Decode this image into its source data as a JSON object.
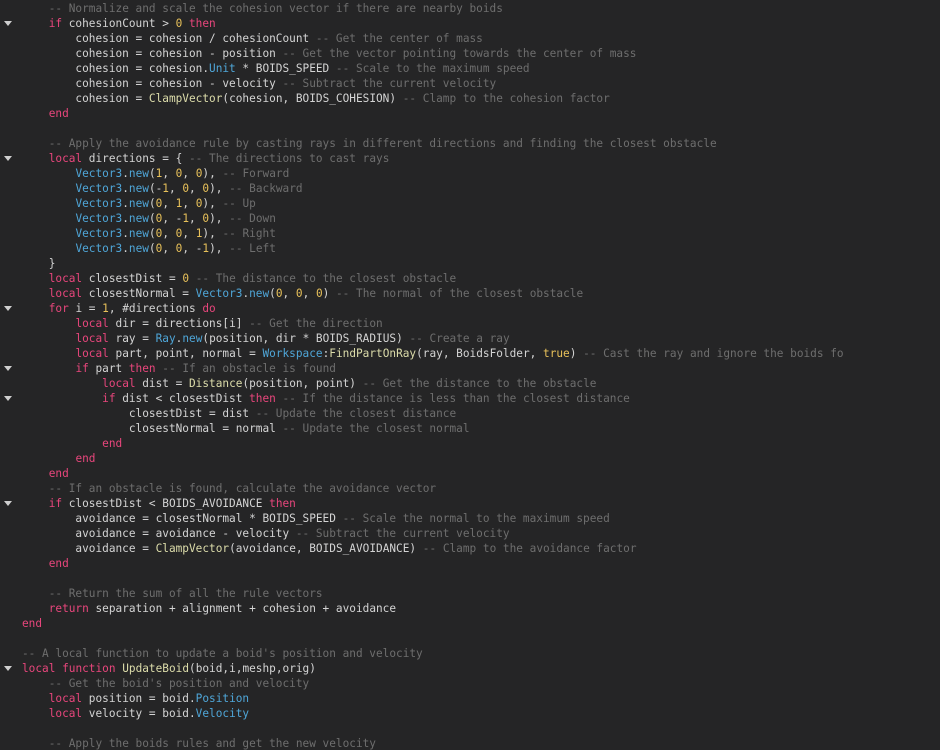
{
  "theme": {
    "background": "#252526",
    "default_text": "#d4d4d4",
    "keyword": "#e8467c",
    "comment": "#6e6e6e",
    "function": "#dcdcaa",
    "number": "#e8c15a",
    "builtin": "#4fa6d8"
  },
  "lines": [
    {
      "fold": false,
      "tokens": [
        {
          "t": "    ",
          "c": "tx"
        },
        {
          "t": "-- Normalize and scale the cohesion vector if there are nearby boids",
          "c": "cm"
        }
      ]
    },
    {
      "fold": true,
      "tokens": [
        {
          "t": "    ",
          "c": "tx"
        },
        {
          "t": "if",
          "c": "kw"
        },
        {
          "t": " cohesionCount > ",
          "c": "tx"
        },
        {
          "t": "0",
          "c": "num"
        },
        {
          "t": " ",
          "c": "tx"
        },
        {
          "t": "then",
          "c": "kw"
        }
      ]
    },
    {
      "fold": false,
      "tokens": [
        {
          "t": "        cohesion = cohesion / cohesionCount ",
          "c": "tx"
        },
        {
          "t": "-- Get the center of mass",
          "c": "cm"
        }
      ]
    },
    {
      "fold": false,
      "tokens": [
        {
          "t": "        cohesion = cohesion - position ",
          "c": "tx"
        },
        {
          "t": "-- Get the vector pointing towards the center of mass",
          "c": "cm"
        }
      ]
    },
    {
      "fold": false,
      "tokens": [
        {
          "t": "        cohesion = cohesion.",
          "c": "tx"
        },
        {
          "t": "Unit",
          "c": "bi"
        },
        {
          "t": " * BOIDS_SPEED ",
          "c": "tx"
        },
        {
          "t": "-- Scale to the maximum speed",
          "c": "cm"
        }
      ]
    },
    {
      "fold": false,
      "tokens": [
        {
          "t": "        cohesion = cohesion - velocity ",
          "c": "tx"
        },
        {
          "t": "-- Subtract the current velocity",
          "c": "cm"
        }
      ]
    },
    {
      "fold": false,
      "tokens": [
        {
          "t": "        cohesion = ",
          "c": "tx"
        },
        {
          "t": "ClampVector",
          "c": "fn"
        },
        {
          "t": "(cohesion, BOIDS_COHESION) ",
          "c": "tx"
        },
        {
          "t": "-- Clamp to the cohesion factor",
          "c": "cm"
        }
      ]
    },
    {
      "fold": false,
      "tokens": [
        {
          "t": "    ",
          "c": "tx"
        },
        {
          "t": "end",
          "c": "kw"
        }
      ]
    },
    {
      "fold": false,
      "tokens": [
        {
          "t": "",
          "c": "tx"
        }
      ]
    },
    {
      "fold": false,
      "tokens": [
        {
          "t": "    ",
          "c": "tx"
        },
        {
          "t": "-- Apply the avoidance rule by casting rays in different directions and finding the closest obstacle",
          "c": "cm"
        }
      ]
    },
    {
      "fold": true,
      "tokens": [
        {
          "t": "    ",
          "c": "tx"
        },
        {
          "t": "local",
          "c": "kw"
        },
        {
          "t": " directions = { ",
          "c": "tx"
        },
        {
          "t": "-- The directions to cast rays",
          "c": "cm"
        }
      ]
    },
    {
      "fold": false,
      "tokens": [
        {
          "t": "        ",
          "c": "tx"
        },
        {
          "t": "Vector3",
          "c": "bi"
        },
        {
          "t": ".",
          "c": "tx"
        },
        {
          "t": "new",
          "c": "bi"
        },
        {
          "t": "(",
          "c": "tx"
        },
        {
          "t": "1",
          "c": "num"
        },
        {
          "t": ", ",
          "c": "tx"
        },
        {
          "t": "0",
          "c": "num"
        },
        {
          "t": ", ",
          "c": "tx"
        },
        {
          "t": "0",
          "c": "num"
        },
        {
          "t": "), ",
          "c": "tx"
        },
        {
          "t": "-- Forward",
          "c": "cm"
        }
      ]
    },
    {
      "fold": false,
      "tokens": [
        {
          "t": "        ",
          "c": "tx"
        },
        {
          "t": "Vector3",
          "c": "bi"
        },
        {
          "t": ".",
          "c": "tx"
        },
        {
          "t": "new",
          "c": "bi"
        },
        {
          "t": "(-",
          "c": "tx"
        },
        {
          "t": "1",
          "c": "num"
        },
        {
          "t": ", ",
          "c": "tx"
        },
        {
          "t": "0",
          "c": "num"
        },
        {
          "t": ", ",
          "c": "tx"
        },
        {
          "t": "0",
          "c": "num"
        },
        {
          "t": "), ",
          "c": "tx"
        },
        {
          "t": "-- Backward",
          "c": "cm"
        }
      ]
    },
    {
      "fold": false,
      "tokens": [
        {
          "t": "        ",
          "c": "tx"
        },
        {
          "t": "Vector3",
          "c": "bi"
        },
        {
          "t": ".",
          "c": "tx"
        },
        {
          "t": "new",
          "c": "bi"
        },
        {
          "t": "(",
          "c": "tx"
        },
        {
          "t": "0",
          "c": "num"
        },
        {
          "t": ", ",
          "c": "tx"
        },
        {
          "t": "1",
          "c": "num"
        },
        {
          "t": ", ",
          "c": "tx"
        },
        {
          "t": "0",
          "c": "num"
        },
        {
          "t": "), ",
          "c": "tx"
        },
        {
          "t": "-- Up",
          "c": "cm"
        }
      ]
    },
    {
      "fold": false,
      "tokens": [
        {
          "t": "        ",
          "c": "tx"
        },
        {
          "t": "Vector3",
          "c": "bi"
        },
        {
          "t": ".",
          "c": "tx"
        },
        {
          "t": "new",
          "c": "bi"
        },
        {
          "t": "(",
          "c": "tx"
        },
        {
          "t": "0",
          "c": "num"
        },
        {
          "t": ", -",
          "c": "tx"
        },
        {
          "t": "1",
          "c": "num"
        },
        {
          "t": ", ",
          "c": "tx"
        },
        {
          "t": "0",
          "c": "num"
        },
        {
          "t": "), ",
          "c": "tx"
        },
        {
          "t": "-- Down",
          "c": "cm"
        }
      ]
    },
    {
      "fold": false,
      "tokens": [
        {
          "t": "        ",
          "c": "tx"
        },
        {
          "t": "Vector3",
          "c": "bi"
        },
        {
          "t": ".",
          "c": "tx"
        },
        {
          "t": "new",
          "c": "bi"
        },
        {
          "t": "(",
          "c": "tx"
        },
        {
          "t": "0",
          "c": "num"
        },
        {
          "t": ", ",
          "c": "tx"
        },
        {
          "t": "0",
          "c": "num"
        },
        {
          "t": ", ",
          "c": "tx"
        },
        {
          "t": "1",
          "c": "num"
        },
        {
          "t": "), ",
          "c": "tx"
        },
        {
          "t": "-- Right",
          "c": "cm"
        }
      ]
    },
    {
      "fold": false,
      "tokens": [
        {
          "t": "        ",
          "c": "tx"
        },
        {
          "t": "Vector3",
          "c": "bi"
        },
        {
          "t": ".",
          "c": "tx"
        },
        {
          "t": "new",
          "c": "bi"
        },
        {
          "t": "(",
          "c": "tx"
        },
        {
          "t": "0",
          "c": "num"
        },
        {
          "t": ", ",
          "c": "tx"
        },
        {
          "t": "0",
          "c": "num"
        },
        {
          "t": ", -",
          "c": "tx"
        },
        {
          "t": "1",
          "c": "num"
        },
        {
          "t": "), ",
          "c": "tx"
        },
        {
          "t": "-- Left",
          "c": "cm"
        }
      ]
    },
    {
      "fold": false,
      "tokens": [
        {
          "t": "    }",
          "c": "tx"
        }
      ]
    },
    {
      "fold": false,
      "tokens": [
        {
          "t": "    ",
          "c": "tx"
        },
        {
          "t": "local",
          "c": "kw"
        },
        {
          "t": " closestDist = ",
          "c": "tx"
        },
        {
          "t": "0",
          "c": "num"
        },
        {
          "t": " ",
          "c": "tx"
        },
        {
          "t": "-- The distance to the closest obstacle",
          "c": "cm"
        }
      ]
    },
    {
      "fold": false,
      "tokens": [
        {
          "t": "    ",
          "c": "tx"
        },
        {
          "t": "local",
          "c": "kw"
        },
        {
          "t": " closestNormal = ",
          "c": "tx"
        },
        {
          "t": "Vector3",
          "c": "bi"
        },
        {
          "t": ".",
          "c": "tx"
        },
        {
          "t": "new",
          "c": "bi"
        },
        {
          "t": "(",
          "c": "tx"
        },
        {
          "t": "0",
          "c": "num"
        },
        {
          "t": ", ",
          "c": "tx"
        },
        {
          "t": "0",
          "c": "num"
        },
        {
          "t": ", ",
          "c": "tx"
        },
        {
          "t": "0",
          "c": "num"
        },
        {
          "t": ") ",
          "c": "tx"
        },
        {
          "t": "-- The normal of the closest obstacle",
          "c": "cm"
        }
      ]
    },
    {
      "fold": true,
      "tokens": [
        {
          "t": "    ",
          "c": "tx"
        },
        {
          "t": "for",
          "c": "kw"
        },
        {
          "t": " i = ",
          "c": "tx"
        },
        {
          "t": "1",
          "c": "num"
        },
        {
          "t": ", #directions ",
          "c": "tx"
        },
        {
          "t": "do",
          "c": "kw"
        }
      ]
    },
    {
      "fold": false,
      "tokens": [
        {
          "t": "        ",
          "c": "tx"
        },
        {
          "t": "local",
          "c": "kw"
        },
        {
          "t": " dir = directions[i] ",
          "c": "tx"
        },
        {
          "t": "-- Get the direction",
          "c": "cm"
        }
      ]
    },
    {
      "fold": false,
      "tokens": [
        {
          "t": "        ",
          "c": "tx"
        },
        {
          "t": "local",
          "c": "kw"
        },
        {
          "t": " ray = ",
          "c": "tx"
        },
        {
          "t": "Ray",
          "c": "bi"
        },
        {
          "t": ".",
          "c": "tx"
        },
        {
          "t": "new",
          "c": "bi"
        },
        {
          "t": "(position, dir * BOIDS_RADIUS) ",
          "c": "tx"
        },
        {
          "t": "-- Create a ray",
          "c": "cm"
        }
      ]
    },
    {
      "fold": false,
      "tokens": [
        {
          "t": "        ",
          "c": "tx"
        },
        {
          "t": "local",
          "c": "kw"
        },
        {
          "t": " part, point, normal = ",
          "c": "tx"
        },
        {
          "t": "Workspace",
          "c": "bi"
        },
        {
          "t": ":",
          "c": "tx"
        },
        {
          "t": "FindPartOnRay",
          "c": "fn"
        },
        {
          "t": "(ray, BoidsFolder, ",
          "c": "tx"
        },
        {
          "t": "true",
          "c": "num"
        },
        {
          "t": ") ",
          "c": "tx"
        },
        {
          "t": "-- Cast the ray and ignore the boids fo",
          "c": "cm"
        }
      ]
    },
    {
      "fold": true,
      "tokens": [
        {
          "t": "        ",
          "c": "tx"
        },
        {
          "t": "if",
          "c": "kw"
        },
        {
          "t": " part ",
          "c": "tx"
        },
        {
          "t": "then",
          "c": "kw"
        },
        {
          "t": " ",
          "c": "tx"
        },
        {
          "t": "-- If an obstacle is found",
          "c": "cm"
        }
      ]
    },
    {
      "fold": false,
      "tokens": [
        {
          "t": "            ",
          "c": "tx"
        },
        {
          "t": "local",
          "c": "kw"
        },
        {
          "t": " dist = ",
          "c": "tx"
        },
        {
          "t": "Distance",
          "c": "fn"
        },
        {
          "t": "(position, point) ",
          "c": "tx"
        },
        {
          "t": "-- Get the distance to the obstacle",
          "c": "cm"
        }
      ]
    },
    {
      "fold": true,
      "tokens": [
        {
          "t": "            ",
          "c": "tx"
        },
        {
          "t": "if",
          "c": "kw"
        },
        {
          "t": " dist < closestDist ",
          "c": "tx"
        },
        {
          "t": "then",
          "c": "kw"
        },
        {
          "t": " ",
          "c": "tx"
        },
        {
          "t": "-- If the distance is less than the closest distance",
          "c": "cm"
        }
      ]
    },
    {
      "fold": false,
      "tokens": [
        {
          "t": "                closestDist = dist ",
          "c": "tx"
        },
        {
          "t": "-- Update the closest distance",
          "c": "cm"
        }
      ]
    },
    {
      "fold": false,
      "tokens": [
        {
          "t": "                closestNormal = normal ",
          "c": "tx"
        },
        {
          "t": "-- Update the closest normal",
          "c": "cm"
        }
      ]
    },
    {
      "fold": false,
      "tokens": [
        {
          "t": "            ",
          "c": "tx"
        },
        {
          "t": "end",
          "c": "kw"
        }
      ]
    },
    {
      "fold": false,
      "tokens": [
        {
          "t": "        ",
          "c": "tx"
        },
        {
          "t": "end",
          "c": "kw"
        }
      ]
    },
    {
      "fold": false,
      "tokens": [
        {
          "t": "    ",
          "c": "tx"
        },
        {
          "t": "end",
          "c": "kw"
        }
      ]
    },
    {
      "fold": false,
      "tokens": [
        {
          "t": "    ",
          "c": "tx"
        },
        {
          "t": "-- If an obstacle is found, calculate the avoidance vector",
          "c": "cm"
        }
      ]
    },
    {
      "fold": true,
      "tokens": [
        {
          "t": "    ",
          "c": "tx"
        },
        {
          "t": "if",
          "c": "kw"
        },
        {
          "t": " closestDist < BOIDS_AVOIDANCE ",
          "c": "tx"
        },
        {
          "t": "then",
          "c": "kw"
        }
      ]
    },
    {
      "fold": false,
      "tokens": [
        {
          "t": "        avoidance = closestNormal * BOIDS_SPEED ",
          "c": "tx"
        },
        {
          "t": "-- Scale the normal to the maximum speed",
          "c": "cm"
        }
      ]
    },
    {
      "fold": false,
      "tokens": [
        {
          "t": "        avoidance = avoidance - velocity ",
          "c": "tx"
        },
        {
          "t": "-- Subtract the current velocity",
          "c": "cm"
        }
      ]
    },
    {
      "fold": false,
      "tokens": [
        {
          "t": "        avoidance = ",
          "c": "tx"
        },
        {
          "t": "ClampVector",
          "c": "fn"
        },
        {
          "t": "(avoidance, BOIDS_AVOIDANCE) ",
          "c": "tx"
        },
        {
          "t": "-- Clamp to the avoidance factor",
          "c": "cm"
        }
      ]
    },
    {
      "fold": false,
      "tokens": [
        {
          "t": "    ",
          "c": "tx"
        },
        {
          "t": "end",
          "c": "kw"
        }
      ]
    },
    {
      "fold": false,
      "tokens": [
        {
          "t": "",
          "c": "tx"
        }
      ]
    },
    {
      "fold": false,
      "tokens": [
        {
          "t": "    ",
          "c": "tx"
        },
        {
          "t": "-- Return the sum of all the rule vectors",
          "c": "cm"
        }
      ]
    },
    {
      "fold": false,
      "tokens": [
        {
          "t": "    ",
          "c": "tx"
        },
        {
          "t": "return",
          "c": "kw"
        },
        {
          "t": " separation + alignment + cohesion + avoidance",
          "c": "tx"
        }
      ]
    },
    {
      "fold": false,
      "tokens": [
        {
          "t": "end",
          "c": "kw"
        }
      ]
    },
    {
      "fold": false,
      "tokens": [
        {
          "t": "",
          "c": "tx"
        }
      ]
    },
    {
      "fold": false,
      "tokens": [
        {
          "t": "-- A local function to update a boid's position and velocity",
          "c": "cm"
        }
      ]
    },
    {
      "fold": true,
      "tokens": [
        {
          "t": "local",
          "c": "kw"
        },
        {
          "t": " ",
          "c": "tx"
        },
        {
          "t": "function",
          "c": "kw"
        },
        {
          "t": " ",
          "c": "tx"
        },
        {
          "t": "UpdateBoid",
          "c": "fn"
        },
        {
          "t": "(boid,i,meshp,orig)",
          "c": "tx"
        }
      ]
    },
    {
      "fold": false,
      "tokens": [
        {
          "t": "    ",
          "c": "tx"
        },
        {
          "t": "-- Get the boid's position and velocity",
          "c": "cm"
        }
      ]
    },
    {
      "fold": false,
      "tokens": [
        {
          "t": "    ",
          "c": "tx"
        },
        {
          "t": "local",
          "c": "kw"
        },
        {
          "t": " position = boid.",
          "c": "tx"
        },
        {
          "t": "Position",
          "c": "bi"
        }
      ]
    },
    {
      "fold": false,
      "tokens": [
        {
          "t": "    ",
          "c": "tx"
        },
        {
          "t": "local",
          "c": "kw"
        },
        {
          "t": " velocity = boid.",
          "c": "tx"
        },
        {
          "t": "Velocity",
          "c": "bi"
        }
      ]
    },
    {
      "fold": false,
      "tokens": [
        {
          "t": "",
          "c": "tx"
        }
      ]
    },
    {
      "fold": false,
      "tokens": [
        {
          "t": "    ",
          "c": "tx"
        },
        {
          "t": "-- Apply the boids rules and get the new velocity",
          "c": "cm"
        }
      ]
    }
  ]
}
